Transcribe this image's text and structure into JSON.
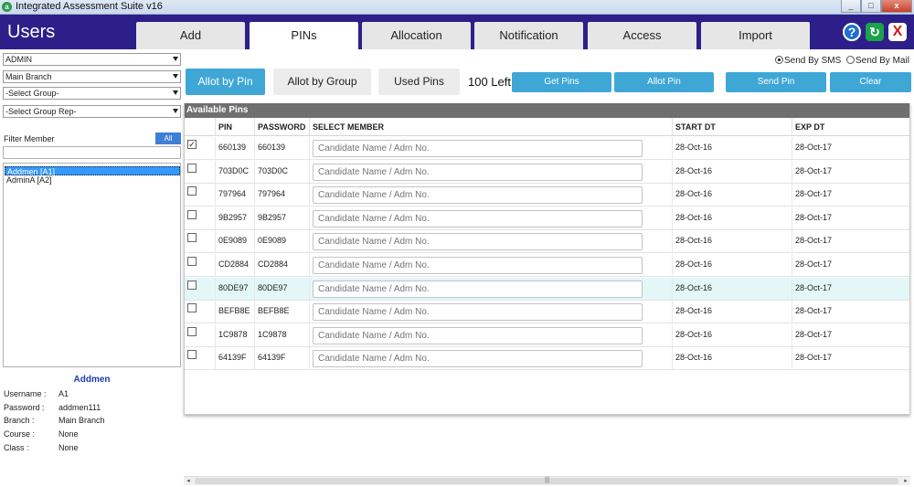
{
  "window": {
    "title": "Integrated Assessment Suite v16",
    "app_icon": "a",
    "min": "_",
    "max": "□",
    "close": "x"
  },
  "header": {
    "page_title": "Users",
    "tabs": [
      {
        "label": "Add"
      },
      {
        "label": "PINs"
      },
      {
        "label": "Allocation"
      },
      {
        "label": "Notification"
      },
      {
        "label": "Access"
      },
      {
        "label": "Import"
      }
    ],
    "help_icon": "?",
    "refresh_icon": "↻",
    "exit_icon": "X",
    "colors": {
      "header_bg": "#2c1f8a",
      "accent": "#3ea7d6"
    }
  },
  "left": {
    "selects": [
      "ADMIN",
      "Main Branch",
      "-Select Group-",
      "-Select Group Rep-"
    ],
    "filter_label": "Filter Member",
    "all_button": "All",
    "members": [
      "Addmen [A1]",
      "AdminA [A2]"
    ],
    "selected_member": "Addmen",
    "info": [
      {
        "key": "Username :",
        "value": "A1"
      },
      {
        "key": "Password :",
        "value": "addmen111"
      },
      {
        "key": "Branch :",
        "value": "Main Branch"
      },
      {
        "key": "Course :",
        "value": "None"
      },
      {
        "key": "Class :",
        "value": "None"
      }
    ]
  },
  "main": {
    "allot_tabs": [
      "Allot by Pin",
      "Allot by Group",
      "Used Pins"
    ],
    "count": "100 Left",
    "actions": [
      "Get Pins",
      "Allot Pin",
      "Send Pin",
      "Clear"
    ],
    "send_options": [
      {
        "label": "Send By SMS",
        "checked": true
      },
      {
        "label": "Send By Mail",
        "checked": false
      }
    ],
    "grid": {
      "caption": "Available Pins",
      "columns": [
        "",
        "PIN",
        "PASSWORD",
        "SELECT MEMBER",
        "START DT",
        "EXP DT"
      ],
      "placeholder": "Candidate Name / Adm No.",
      "rows": [
        {
          "checked": "✓",
          "pin": "660139",
          "password": "660139",
          "start": "28-Oct-16",
          "exp": "28-Oct-17"
        },
        {
          "checked": "",
          "pin": "703D0C",
          "password": "703D0C",
          "start": "28-Oct-16",
          "exp": "28-Oct-17"
        },
        {
          "checked": "",
          "pin": "797964",
          "password": "797964",
          "start": "28-Oct-16",
          "exp": "28-Oct-17"
        },
        {
          "checked": "",
          "pin": "9B2957",
          "password": "9B2957",
          "start": "28-Oct-16",
          "exp": "28-Oct-17"
        },
        {
          "checked": "",
          "pin": "0E9089",
          "password": "0E9089",
          "start": "28-Oct-16",
          "exp": "28-Oct-17"
        },
        {
          "checked": "",
          "pin": "CD2884",
          "password": "CD2884",
          "start": "28-Oct-16",
          "exp": "28-Oct-17"
        },
        {
          "checked": "",
          "pin": "80DE97",
          "password": "80DE97",
          "start": "28-Oct-16",
          "exp": "28-Oct-17"
        },
        {
          "checked": "",
          "pin": "BEFB8E",
          "password": "BEFB8E",
          "start": "28-Oct-16",
          "exp": "28-Oct-17"
        },
        {
          "checked": "",
          "pin": "1C9878",
          "password": "1C9878",
          "start": "28-Oct-16",
          "exp": "28-Oct-17"
        },
        {
          "checked": "",
          "pin": "64139F",
          "password": "64139F",
          "start": "28-Oct-16",
          "exp": "28-Oct-17"
        }
      ]
    },
    "scroll": {
      "left": "◂",
      "right": "▸",
      "grip": "|||"
    }
  }
}
